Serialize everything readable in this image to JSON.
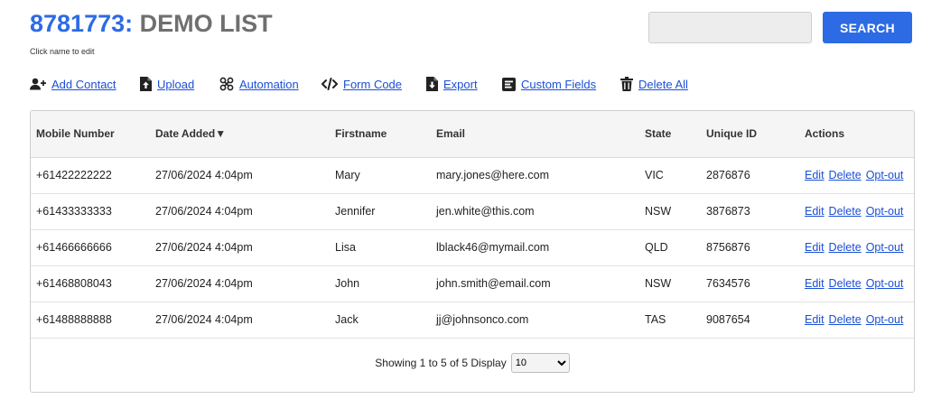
{
  "header": {
    "list_id": "8781773:",
    "list_name": "DEMO LIST",
    "subtitle": "Click name to edit"
  },
  "search": {
    "placeholder": "",
    "value": "",
    "button_label": "SEARCH"
  },
  "toolbar": {
    "items": [
      {
        "label": "Add Contact",
        "icon": "add-user-icon"
      },
      {
        "label": "Upload",
        "icon": "upload-file-icon"
      },
      {
        "label": "Automation",
        "icon": "automation-icon"
      },
      {
        "label": "Form Code",
        "icon": "code-icon"
      },
      {
        "label": "Export",
        "icon": "export-file-icon"
      },
      {
        "label": "Custom Fields",
        "icon": "custom-fields-icon"
      },
      {
        "label": "Delete All",
        "icon": "trash-icon"
      }
    ]
  },
  "table": {
    "columns": [
      "Mobile Number",
      "Date Added▼",
      "Firstname",
      "Email",
      "State",
      "Unique ID",
      "Actions"
    ],
    "action_labels": [
      "Edit",
      "Delete",
      "Opt-out"
    ],
    "rows": [
      {
        "mobile": "+61422222222",
        "date_added": "27/06/2024 4:04pm",
        "firstname": "Mary",
        "email": "mary.jones@here.com",
        "state": "VIC",
        "unique_id": "2876876"
      },
      {
        "mobile": "+61433333333",
        "date_added": "27/06/2024 4:04pm",
        "firstname": "Jennifer",
        "email": "jen.white@this.com",
        "state": "NSW",
        "unique_id": "3876873"
      },
      {
        "mobile": "+61466666666",
        "date_added": "27/06/2024 4:04pm",
        "firstname": "Lisa",
        "email": "lblack46@mymail.com",
        "state": "QLD",
        "unique_id": "8756876"
      },
      {
        "mobile": "+61468808043",
        "date_added": "27/06/2024 4:04pm",
        "firstname": "John",
        "email": "john.smith@email.com",
        "state": "NSW",
        "unique_id": "7634576"
      },
      {
        "mobile": "+61488888888",
        "date_added": "27/06/2024 4:04pm",
        "firstname": "Jack",
        "email": "jj@johnsonco.com",
        "state": "TAS",
        "unique_id": "9087654"
      }
    ]
  },
  "pagination": {
    "showing_text": "Showing 1 to 5 of 5",
    "display_label": "Display",
    "display_options": [
      "10"
    ],
    "display_value": "10"
  },
  "colors": {
    "accent": "#2d6be4",
    "link": "#1a4fd6",
    "title_gray": "#6f6f6f"
  }
}
